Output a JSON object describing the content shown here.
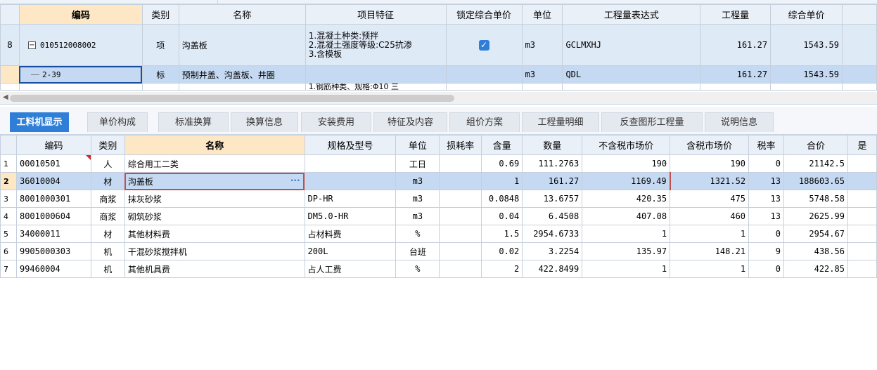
{
  "upper": {
    "headers": [
      "编码",
      "类别",
      "名称",
      "项目特征",
      "锁定综合单价",
      "单位",
      "工程量表达式",
      "工程量",
      "综合单价"
    ],
    "rows": [
      {
        "row_no": "8",
        "code": "010512008002",
        "type": "项",
        "name": "沟盖板",
        "features": [
          "1.混凝土种类:预拌",
          "2.混凝土强度等级:C25抗渗",
          "3.含模板"
        ],
        "unit": "m3",
        "expr": "GCLMXHJ",
        "qty": "161.27",
        "price": "1543.59"
      },
      {
        "row_no": "",
        "code": "2-39",
        "type": "标",
        "name": "预制井盖、沟盖板、井圈",
        "features": [],
        "unit": "m3",
        "expr": "QDL",
        "qty": "161.27",
        "price": "1543.59"
      }
    ],
    "partial_row_text": "1.钢筋种类、规格:Φ10 三"
  },
  "tabs": [
    "工料机显示",
    "单价构成",
    "标准换算",
    "换算信息",
    "安装费用",
    "特征及内容",
    "组价方案",
    "工程量明细",
    "反查图形工程量",
    "说明信息"
  ],
  "lower": {
    "headers": [
      "编码",
      "类别",
      "名称",
      "规格及型号",
      "单位",
      "损耗率",
      "含量",
      "数量",
      "不含税市场价",
      "含税市场价",
      "税率",
      "合价",
      "是"
    ],
    "rows": [
      {
        "no": "1",
        "code": "00010501",
        "type": "人",
        "name": "综合用工二类",
        "spec": "",
        "unit": "工日",
        "loss": "",
        "content": "0.69",
        "qty": "111.2763",
        "price_ex": "190",
        "price_in": "190",
        "tax": "0",
        "total": "21142.5"
      },
      {
        "no": "2",
        "code": "36010004",
        "type": "材",
        "name": "沟盖板",
        "spec": "",
        "unit": "m3",
        "loss": "",
        "content": "1",
        "qty": "161.27",
        "price_ex": "1169.49",
        "price_in": "1321.52",
        "tax": "13",
        "total": "188603.65"
      },
      {
        "no": "3",
        "code": "8001000301",
        "type": "商浆",
        "name": "抹灰砂浆",
        "spec": "DP-HR",
        "unit": "m3",
        "loss": "",
        "content": "0.0848",
        "qty": "13.6757",
        "price_ex": "420.35",
        "price_in": "475",
        "tax": "13",
        "total": "5748.58"
      },
      {
        "no": "4",
        "code": "8001000604",
        "type": "商浆",
        "name": "砌筑砂浆",
        "spec": "DM5.0-HR",
        "unit": "m3",
        "loss": "",
        "content": "0.04",
        "qty": "6.4508",
        "price_ex": "407.08",
        "price_in": "460",
        "tax": "13",
        "total": "2625.99"
      },
      {
        "no": "5",
        "code": "34000011",
        "type": "材",
        "name": "其他材料费",
        "spec": "占材料费",
        "unit": "%",
        "loss": "",
        "content": "1.5",
        "qty": "2954.6733",
        "price_ex": "1",
        "price_in": "1",
        "tax": "0",
        "total": "2954.67"
      },
      {
        "no": "6",
        "code": "9905000303",
        "type": "机",
        "name": "干混砂浆搅拌机",
        "spec": "200L",
        "unit": "台班",
        "loss": "",
        "content": "0.02",
        "qty": "3.2254",
        "price_ex": "135.97",
        "price_in": "148.21",
        "tax": "9",
        "total": "438.56"
      },
      {
        "no": "7",
        "code": "99460004",
        "type": "机",
        "name": "其他机具费",
        "spec": "占人工费",
        "unit": "%",
        "loss": "",
        "content": "2",
        "qty": "422.8499",
        "price_ex": "1",
        "price_in": "1",
        "tax": "0",
        "total": "422.85"
      }
    ],
    "edit_dots": "···"
  },
  "icons": {
    "checkbox": "check-icon",
    "tree_collapse": "minus-box-icon",
    "scroll_left": "arrow-left-icon"
  },
  "colors": {
    "accent": "#2f7fd8",
    "selected_row": "#c5daf2",
    "header_highlight": "#fde7c5"
  }
}
